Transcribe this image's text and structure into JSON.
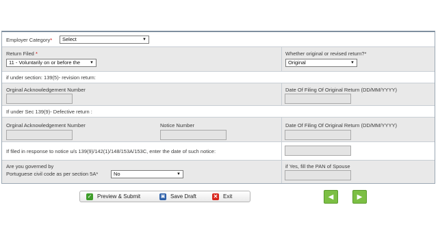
{
  "employer": {
    "label": "Employer Category",
    "required_mark": "*",
    "value": "Select"
  },
  "return_filed": {
    "label": "Return Filed",
    "required_mark": "*",
    "value": "11 - Voluntarily on or before the"
  },
  "original_revised": {
    "label": "Whether original or revised return?*",
    "value": "Original"
  },
  "section_139_5": {
    "heading": "if under section: 139(5)- revision return:",
    "ack_label": "Orginal Acknowledgement Number",
    "date_label": "Date Of Filing Of Original Return (DD/MM/YYYY)"
  },
  "section_139_9": {
    "heading": "If under Sec 139(9)- Defective return :",
    "ack_label": "Orginal Acknowledgement Number",
    "notice_label": "Notice Number",
    "date_label": "Date Of Filing Of Original Return (DD/MM/YYYY)"
  },
  "notice_date": {
    "label": "If filed in response to notice u/s 139(9)/142(1)/148/153A/153C, enter the date of such notice:"
  },
  "portuguese": {
    "label_line1": "Are you governed by",
    "label_line2": "Portuguese civil code as per section 5A*",
    "value": "No",
    "pan_label": "if Yes, fill the PAN of Spouse"
  },
  "buttons": {
    "preview": "Preview & Submit",
    "save": "Save Draft",
    "exit": "Exit"
  },
  "icons": {
    "preview": "check-icon",
    "save": "floppy-disk-icon",
    "exit": "x-icon",
    "prev": "arrow-left-icon",
    "next": "arrow-right-icon"
  },
  "colors": {
    "nav_green": "#7cbf44",
    "row_gray": "#e9e9e9",
    "border": "#9aa7b3"
  }
}
